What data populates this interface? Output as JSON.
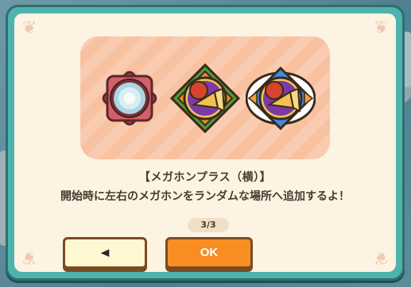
{
  "dialog": {
    "title": "【メガホンプラス（横）】",
    "description": "開始時に左右のメガホンをランダムな場所へ追加するよ！",
    "page_indicator": "3/3",
    "back_button": {
      "label": "◀",
      "icon": "left-triangle-icon"
    },
    "ok_button": {
      "label": "OK"
    }
  },
  "preview": {
    "badges": [
      {
        "name": "empty-glow-badge",
        "frame_color": "#c8505a",
        "center": "light-blue-glow"
      },
      {
        "name": "megaphone-badge-green",
        "frame_color": "#4e9a3c",
        "center": "megaphone"
      },
      {
        "name": "megaphone-badge-blue-selected",
        "frame_color": "#3f8de0",
        "center": "megaphone"
      }
    ]
  },
  "colors": {
    "modal_border": "#4fb3ad",
    "modal_background": "#fdf3e3",
    "preview_background": "#f8c1a0",
    "ok_button": "#f88e21",
    "back_button": "#fff7d2"
  }
}
